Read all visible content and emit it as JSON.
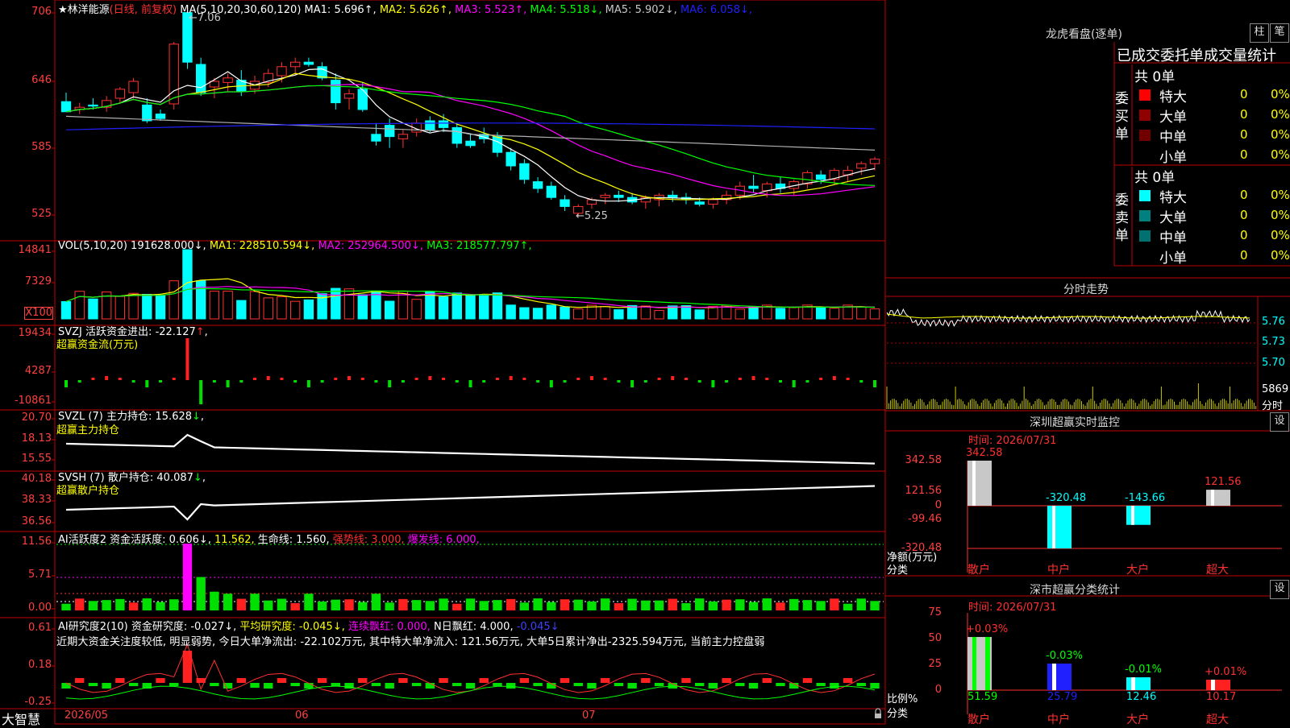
{
  "app": {
    "brand": "大智慧",
    "lock_icon": "lock-icon"
  },
  "stock": {
    "name": "林洋能源",
    "period": "(日线, 前复权)",
    "star": "★"
  },
  "price_pane": {
    "ma_title": "MA(5,10,20,30,60,120)",
    "ma": [
      {
        "label": "MA1:",
        "value": "5.696",
        "arrow": "↑",
        "color": "#ffffff"
      },
      {
        "label": "MA2:",
        "value": "5.626",
        "arrow": "↑",
        "color": "#ffff00"
      },
      {
        "label": "MA3:",
        "value": "5.523",
        "arrow": "↑",
        "color": "#ff00ff"
      },
      {
        "label": "MA4:",
        "value": "5.518",
        "arrow": "↓",
        "color": "#00ff00"
      },
      {
        "label": "MA5:",
        "value": "5.902",
        "arrow": "↓",
        "color": "#c8c8c8"
      },
      {
        "label": "MA6:",
        "value": "6.058",
        "arrow": "↓",
        "color": "#2020ff"
      }
    ],
    "y_ticks": [
      "706",
      "646",
      "585",
      "525"
    ],
    "high_mark": "←7.06",
    "low_mark": "←5.25"
  },
  "vol_pane": {
    "title": "VOL(5,10,20)",
    "value": "191628.000",
    "value_arrow": "↓",
    "ma": [
      {
        "label": "MA1:",
        "value": "228510.594",
        "arrow": "↓",
        "color": "#ffff00"
      },
      {
        "label": "MA2:",
        "value": "252964.500",
        "arrow": "↓",
        "color": "#ff00ff"
      },
      {
        "label": "MA3:",
        "value": "218577.797",
        "arrow": "↑",
        "color": "#00ff00"
      }
    ],
    "y_ticks": [
      "14841",
      "7329"
    ],
    "unit": "X100"
  },
  "svzj_pane": {
    "title": "SVZJ",
    "label": "活跃资金进出:",
    "value": "-22.127",
    "arrow": "↑",
    "subtitle": "超赢资金流(万元)",
    "y_ticks": [
      "19434",
      "4287",
      "-10861"
    ]
  },
  "svzl_pane": {
    "title": "SVZL (7)",
    "label": "主力持仓:",
    "value": "15.628",
    "arrow": "↓",
    "subtitle": "超赢主力持仓",
    "y_ticks": [
      "20.70",
      "18.13",
      "15.55"
    ]
  },
  "svsh_pane": {
    "title": "SVSH (7)",
    "label": "散户持仓:",
    "value": "40.087",
    "arrow": "↓",
    "subtitle": "超赢散户持仓",
    "y_ticks": [
      "40.18",
      "38.33",
      "36.56"
    ]
  },
  "ai_active_pane": {
    "title": "AI活跃度2",
    "items": [
      {
        "text": "资金活跃度: 0.606↓,",
        "color": "#ffffff"
      },
      {
        "text": "11.562,",
        "color": "#ffff00"
      },
      {
        "text": "生命线: 1.560,",
        "color": "#ffffff"
      },
      {
        "text": "强势线: 3.000,",
        "color": "#ff3030"
      },
      {
        "text": "爆发线: 6.000,",
        "color": "#ff00ff"
      }
    ],
    "y_ticks": [
      "11.56",
      "5.71",
      "0.00"
    ]
  },
  "ai_research_pane": {
    "title": "AI研究度2(10)",
    "items": [
      {
        "text": "资金研究度: -0.027↓,",
        "color": "#ffffff"
      },
      {
        "text": "平均研究度: -0.045↓,",
        "color": "#ffff00"
      },
      {
        "text": "连续飘红: 0.000,",
        "color": "#ff00ff"
      },
      {
        "text": "N日飘红: 4.000,",
        "color": "#ffffff"
      },
      {
        "text": "-0.045↓",
        "color": "#4040ff"
      }
    ],
    "comment": "近期大资金关注度较低, 明显弱势, 今日大单净流出: -22.102万元, 其中特大单净流入: 121.56万元, 大单5日累计净出-2325.594万元, 当前主力控盘弱",
    "y_ticks": [
      "0.61",
      "0.18",
      "-0.25"
    ]
  },
  "x_axis": {
    "labels": [
      "2026/05",
      "06",
      "07"
    ]
  },
  "right": {
    "lhb": {
      "title": "龙虎看盘(逐单)",
      "btn_zhu": "柱",
      "btn_bi": "笔",
      "header": "已成交委托单成交量统计",
      "buy": {
        "side_label": "委买单",
        "total": "共 0单",
        "rows": [
          {
            "label": "特大",
            "count": "0",
            "pct": "0%",
            "color": "#ff0000"
          },
          {
            "label": "大单",
            "count": "0",
            "pct": "0%",
            "color": "#900000"
          },
          {
            "label": "中单",
            "count": "0",
            "pct": "0%",
            "color": "#700000"
          },
          {
            "label": "小单",
            "count": "0",
            "pct": "0%",
            "color": ""
          }
        ]
      },
      "sell": {
        "side_label": "委卖单",
        "total": "共 0单",
        "rows": [
          {
            "label": "特大",
            "count": "0",
            "pct": "0%",
            "color": "#00ffff"
          },
          {
            "label": "大单",
            "count": "0",
            "pct": "0%",
            "color": "#008080"
          },
          {
            "label": "中单",
            "count": "0",
            "pct": "0%",
            "color": "#007070"
          },
          {
            "label": "小单",
            "count": "0",
            "pct": "0%",
            "color": ""
          }
        ]
      }
    },
    "intraday": {
      "title": "分时走势",
      "y_ticks": [
        "5.76",
        "5.73",
        "5.70"
      ],
      "vol_tick": "5869",
      "vol_label": "分时"
    },
    "sz_monitor": {
      "title": "深圳超赢实时监控",
      "btn": "设",
      "time": "时间: 2026/07/31",
      "y_ticks": [
        "342.58",
        "121.56",
        "0",
        "-99.46",
        "-320.48"
      ],
      "ylabel": "净额(万元)",
      "xlabel": "分类",
      "categories": [
        "散户",
        "中户",
        "大户",
        "超大"
      ],
      "values": [
        "342.58",
        "-320.48",
        "-143.66",
        "121.56"
      ]
    },
    "sz_class": {
      "title": "深市超赢分类统计",
      "btn": "设",
      "time": "时间: 2026/07/31",
      "y_ticks": [
        "75",
        "50",
        "25",
        "0"
      ],
      "ylabel": "比例%",
      "xlabel": "分类",
      "categories": [
        "散户",
        "中户",
        "大户",
        "超大"
      ],
      "values": [
        "51.59",
        "25.79",
        "12.46",
        "10.17"
      ],
      "deltas": [
        "+0.03%",
        "-0.03%",
        "-0.01%",
        "+0.01%"
      ]
    }
  },
  "chart_data": [
    {
      "type": "candlestick",
      "title": "林洋能源",
      "ylim": [
        5.1,
        7.1
      ],
      "ohlc": [
        [
          6.27,
          6.35,
          6.22,
          6.18
        ],
        [
          6.2,
          6.26,
          6.16,
          6.22
        ],
        [
          6.24,
          6.3,
          6.2,
          6.23
        ],
        [
          6.22,
          6.32,
          6.18,
          6.28
        ],
        [
          6.3,
          6.4,
          6.26,
          6.38
        ],
        [
          6.35,
          6.48,
          6.3,
          6.45
        ],
        [
          6.24,
          6.3,
          6.08,
          6.1
        ],
        [
          6.16,
          6.2,
          6.1,
          6.12
        ],
        [
          6.25,
          6.8,
          6.2,
          6.78
        ],
        [
          7.06,
          7.08,
          6.56,
          6.62
        ],
        [
          6.6,
          6.66,
          6.32,
          6.35
        ],
        [
          6.4,
          6.48,
          6.3,
          6.45
        ],
        [
          6.44,
          6.52,
          6.36,
          6.48
        ],
        [
          6.46,
          6.55,
          6.32,
          6.36
        ],
        [
          6.38,
          6.5,
          6.34,
          6.45
        ],
        [
          6.44,
          6.56,
          6.4,
          6.52
        ],
        [
          6.5,
          6.62,
          6.44,
          6.58
        ],
        [
          6.58,
          6.66,
          6.5,
          6.62
        ],
        [
          6.62,
          6.66,
          6.58,
          6.6
        ],
        [
          6.58,
          6.62,
          6.46,
          6.48
        ],
        [
          6.46,
          6.52,
          6.2,
          6.26
        ],
        [
          6.3,
          6.38,
          6.2,
          6.34
        ],
        [
          6.38,
          6.44,
          6.18,
          6.2
        ],
        [
          5.98,
          6.08,
          5.88,
          5.92
        ],
        [
          6.06,
          6.12,
          5.86,
          5.96
        ],
        [
          5.94,
          6.02,
          5.86,
          5.98
        ],
        [
          6.0,
          6.12,
          5.96,
          6.08
        ],
        [
          6.1,
          6.14,
          6.0,
          6.02
        ],
        [
          6.1,
          6.16,
          6.0,
          6.04
        ],
        [
          6.04,
          6.08,
          5.86,
          5.9
        ],
        [
          5.92,
          5.98,
          5.86,
          5.88
        ],
        [
          5.98,
          6.04,
          5.9,
          5.94
        ],
        [
          5.96,
          6.0,
          5.78,
          5.82
        ],
        [
          5.82,
          5.86,
          5.66,
          5.7
        ],
        [
          5.72,
          5.76,
          5.54,
          5.58
        ],
        [
          5.56,
          5.6,
          5.46,
          5.5
        ],
        [
          5.52,
          5.56,
          5.4,
          5.42
        ],
        [
          5.4,
          5.44,
          5.3,
          5.34
        ],
        [
          5.28,
          5.36,
          5.25,
          5.34
        ],
        [
          5.36,
          5.42,
          5.32,
          5.4
        ],
        [
          5.42,
          5.46,
          5.36,
          5.44
        ],
        [
          5.44,
          5.48,
          5.38,
          5.42
        ],
        [
          5.42,
          5.46,
          5.36,
          5.38
        ],
        [
          5.38,
          5.44,
          5.32,
          5.42
        ],
        [
          5.4,
          5.46,
          5.34,
          5.44
        ],
        [
          5.44,
          5.48,
          5.38,
          5.42
        ],
        [
          5.42,
          5.46,
          5.36,
          5.4
        ],
        [
          5.38,
          5.42,
          5.34,
          5.36
        ],
        [
          5.36,
          5.42,
          5.32,
          5.4
        ],
        [
          5.4,
          5.48,
          5.36,
          5.44
        ],
        [
          5.44,
          5.56,
          5.4,
          5.52
        ],
        [
          5.52,
          5.62,
          5.46,
          5.5
        ],
        [
          5.48,
          5.56,
          5.42,
          5.54
        ],
        [
          5.54,
          5.6,
          5.46,
          5.5
        ],
        [
          5.5,
          5.58,
          5.44,
          5.56
        ],
        [
          5.54,
          5.66,
          5.5,
          5.64
        ],
        [
          5.62,
          5.66,
          5.54,
          5.58
        ],
        [
          5.58,
          5.68,
          5.54,
          5.66
        ],
        [
          5.62,
          5.7,
          5.56,
          5.66
        ],
        [
          5.68,
          5.74,
          5.62,
          5.72
        ],
        [
          5.72,
          5.78,
          5.66,
          5.76
        ]
      ]
    }
  ]
}
